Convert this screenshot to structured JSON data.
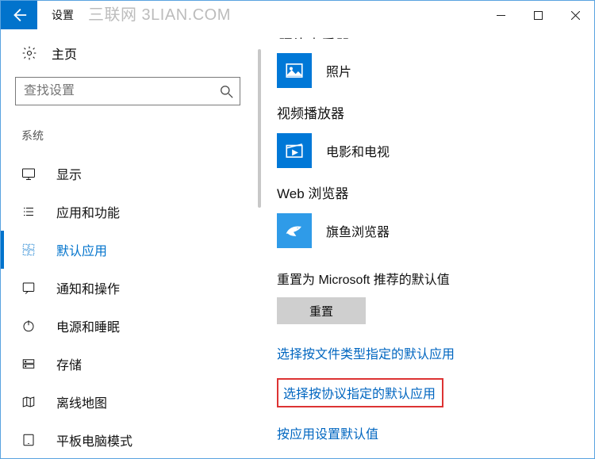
{
  "titlebar": {
    "back_aria": "返回",
    "title": "设置",
    "watermark": "三联网 3LIAN.COM"
  },
  "sidebar": {
    "home_label": "主页",
    "search_placeholder": "查找设置",
    "group_label": "系统",
    "items": [
      {
        "key": "display",
        "label": "显示"
      },
      {
        "key": "apps",
        "label": "应用和功能"
      },
      {
        "key": "defaults",
        "label": "默认应用",
        "active": true
      },
      {
        "key": "notify",
        "label": "通知和操作"
      },
      {
        "key": "power",
        "label": "电源和睡眠"
      },
      {
        "key": "storage",
        "label": "存储"
      },
      {
        "key": "maps",
        "label": "离线地图"
      },
      {
        "key": "tablet",
        "label": "平板电脑模式"
      }
    ]
  },
  "content": {
    "photo_viewer_heading": "照片查看器",
    "photo_app": "照片",
    "video_heading": "视频播放器",
    "video_app": "电影和电视",
    "browser_heading": "Web 浏览器",
    "browser_app": "旗鱼浏览器",
    "reset_label": "重置为 Microsoft 推荐的默认值",
    "reset_button": "重置",
    "link_filetype": "选择按文件类型指定的默认应用",
    "link_protocol": "选择按协议指定的默认应用",
    "link_byapp": "按应用设置默认值"
  },
  "colors": {
    "accent": "#0173cc",
    "link": "#0066c0",
    "highlight_box": "#d33"
  }
}
